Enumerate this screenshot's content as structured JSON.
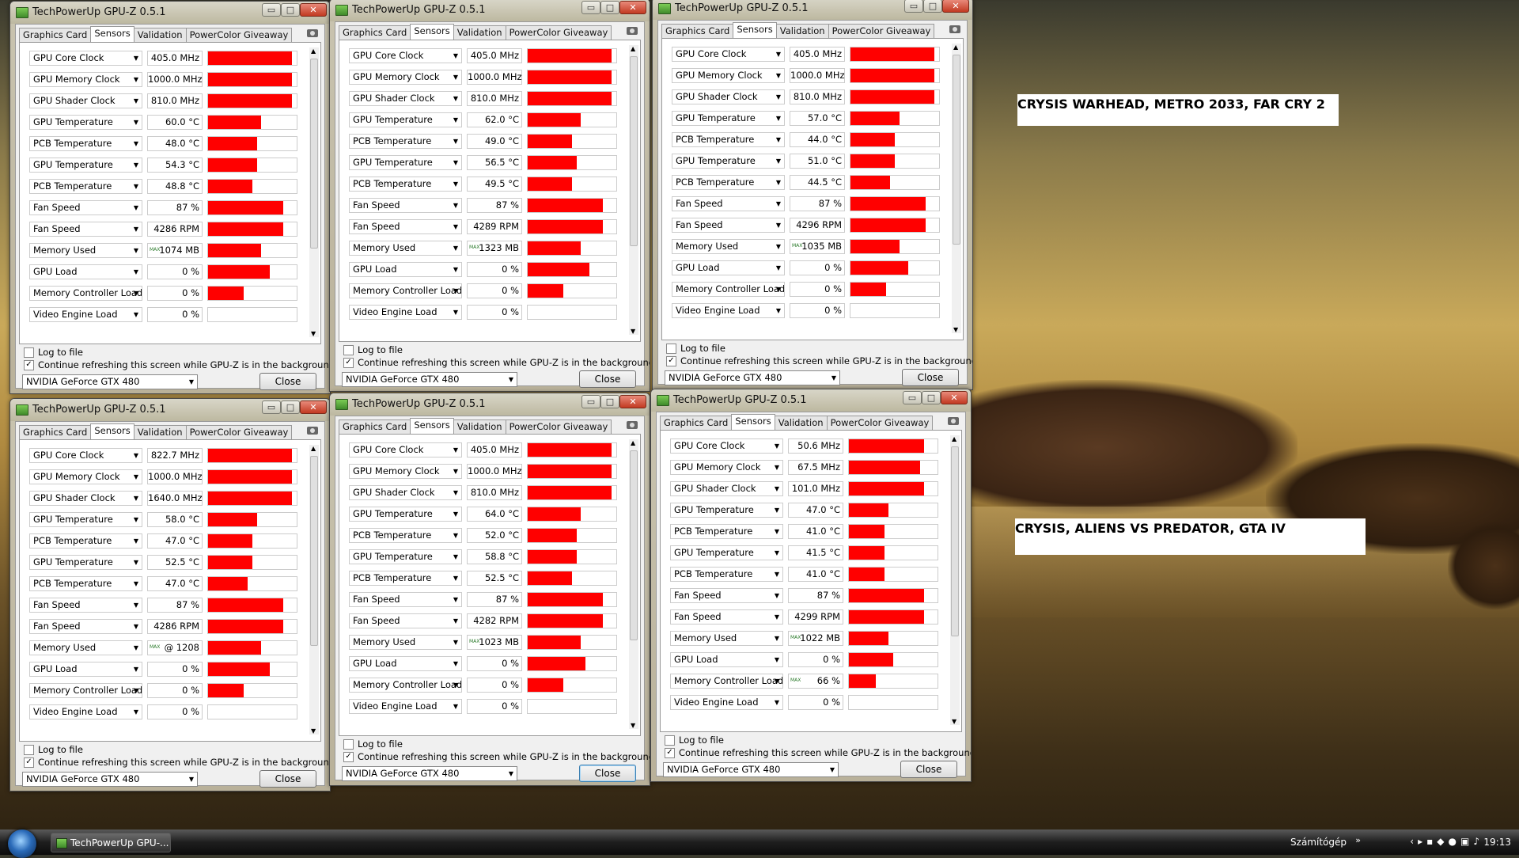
{
  "desktop": {
    "captions": [
      "CRYSIS WARHEAD, METRO 2033, FAR CRY 2",
      "CRYSIS, ALIENS VS PREDATOR, GTA IV"
    ]
  },
  "common": {
    "title": "TechPowerUp GPU-Z 0.5.1",
    "tabs": [
      "Graphics Card",
      "Sensors",
      "Validation",
      "PowerColor Giveaway"
    ],
    "log_label": "Log to file",
    "continue_label": "Continue refreshing this screen while GPU-Z is in the background",
    "gpu_select": "NVIDIA GeForce GTX 480",
    "close_label": "Close",
    "min_glyph": "▭",
    "max_glyph": "□",
    "close_glyph": "✕",
    "arrow": "▼",
    "max_tag": "MAX",
    "check_glyph": "✓"
  },
  "windows": [
    {
      "sensors": [
        {
          "name": "GPU Core Clock",
          "value": "405.0 MHz",
          "level": 0.95
        },
        {
          "name": "GPU Memory Clock",
          "value": "1000.0 MHz",
          "level": 0.95
        },
        {
          "name": "GPU Shader Clock",
          "value": "810.0 MHz",
          "level": 0.95
        },
        {
          "name": "GPU Temperature",
          "value": "60.0 °C",
          "level": 0.6
        },
        {
          "name": "PCB Temperature",
          "value": "48.0 °C",
          "level": 0.55
        },
        {
          "name": "GPU Temperature",
          "value": "54.3 °C",
          "level": 0.55
        },
        {
          "name": "PCB Temperature",
          "value": "48.8 °C",
          "level": 0.5
        },
        {
          "name": "Fan Speed",
          "value": "87 %",
          "level": 0.85
        },
        {
          "name": "Fan Speed",
          "value": "4286 RPM",
          "level": 0.85
        },
        {
          "name": "Memory Used",
          "value": "1074 MB",
          "level": 0.6,
          "max": true
        },
        {
          "name": "GPU Load",
          "value": "0 %",
          "level": 0.7
        },
        {
          "name": "Memory Controller Load",
          "value": "0 %",
          "level": 0.4
        },
        {
          "name": "Video Engine Load",
          "value": "0 %",
          "level": 0.0
        }
      ]
    },
    {
      "sensors": [
        {
          "name": "GPU Core Clock",
          "value": "405.0 MHz",
          "level": 0.95
        },
        {
          "name": "GPU Memory Clock",
          "value": "1000.0 MHz",
          "level": 0.95
        },
        {
          "name": "GPU Shader Clock",
          "value": "810.0 MHz",
          "level": 0.95
        },
        {
          "name": "GPU Temperature",
          "value": "62.0 °C",
          "level": 0.6
        },
        {
          "name": "PCB Temperature",
          "value": "49.0 °C",
          "level": 0.5
        },
        {
          "name": "GPU Temperature",
          "value": "56.5 °C",
          "level": 0.55
        },
        {
          "name": "PCB Temperature",
          "value": "49.5 °C",
          "level": 0.5
        },
        {
          "name": "Fan Speed",
          "value": "87 %",
          "level": 0.85
        },
        {
          "name": "Fan Speed",
          "value": "4289 RPM",
          "level": 0.85
        },
        {
          "name": "Memory Used",
          "value": "1323 MB",
          "level": 0.6,
          "max": true
        },
        {
          "name": "GPU Load",
          "value": "0 %",
          "level": 0.7
        },
        {
          "name": "Memory Controller Load",
          "value": "0 %",
          "level": 0.4
        },
        {
          "name": "Video Engine Load",
          "value": "0 %",
          "level": 0.0
        }
      ]
    },
    {
      "sensors": [
        {
          "name": "GPU Core Clock",
          "value": "405.0 MHz",
          "level": 0.95
        },
        {
          "name": "GPU Memory Clock",
          "value": "1000.0 MHz",
          "level": 0.95
        },
        {
          "name": "GPU Shader Clock",
          "value": "810.0 MHz",
          "level": 0.95
        },
        {
          "name": "GPU Temperature",
          "value": "57.0 °C",
          "level": 0.55
        },
        {
          "name": "PCB Temperature",
          "value": "44.0 °C",
          "level": 0.5
        },
        {
          "name": "GPU Temperature",
          "value": "51.0 °C",
          "level": 0.5
        },
        {
          "name": "PCB Temperature",
          "value": "44.5 °C",
          "level": 0.45
        },
        {
          "name": "Fan Speed",
          "value": "87 %",
          "level": 0.85
        },
        {
          "name": "Fan Speed",
          "value": "4296 RPM",
          "level": 0.85
        },
        {
          "name": "Memory Used",
          "value": "1035 MB",
          "level": 0.55,
          "max": true
        },
        {
          "name": "GPU Load",
          "value": "0 %",
          "level": 0.65
        },
        {
          "name": "Memory Controller Load",
          "value": "0 %",
          "level": 0.4
        },
        {
          "name": "Video Engine Load",
          "value": "0 %",
          "level": 0.0
        }
      ]
    },
    {
      "sensors": [
        {
          "name": "GPU Core Clock",
          "value": "822.7 MHz",
          "level": 0.95
        },
        {
          "name": "GPU Memory Clock",
          "value": "1000.0 MHz",
          "level": 0.95
        },
        {
          "name": "GPU Shader Clock",
          "value": "1640.0 MHz",
          "level": 0.95
        },
        {
          "name": "GPU Temperature",
          "value": "58.0 °C",
          "level": 0.55
        },
        {
          "name": "PCB Temperature",
          "value": "47.0 °C",
          "level": 0.5
        },
        {
          "name": "GPU Temperature",
          "value": "52.5 °C",
          "level": 0.5
        },
        {
          "name": "PCB Temperature",
          "value": "47.0 °C",
          "level": 0.45
        },
        {
          "name": "Fan Speed",
          "value": "87 %",
          "level": 0.85
        },
        {
          "name": "Fan Speed",
          "value": "4286 RPM",
          "level": 0.85
        },
        {
          "name": "Memory Used",
          "value": "@ 1208",
          "level": 0.6,
          "max": true
        },
        {
          "name": "GPU Load",
          "value": "0 %",
          "level": 0.7
        },
        {
          "name": "Memory Controller Load",
          "value": "0 %",
          "level": 0.4
        },
        {
          "name": "Video Engine Load",
          "value": "0 %",
          "level": 0.0
        }
      ]
    },
    {
      "sensors": [
        {
          "name": "GPU Core Clock",
          "value": "405.0 MHz",
          "level": 0.95
        },
        {
          "name": "GPU Memory Clock",
          "value": "1000.0 MHz",
          "level": 0.95
        },
        {
          "name": "GPU Shader Clock",
          "value": "810.0 MHz",
          "level": 0.95
        },
        {
          "name": "GPU Temperature",
          "value": "64.0 °C",
          "level": 0.6
        },
        {
          "name": "PCB Temperature",
          "value": "52.0 °C",
          "level": 0.55
        },
        {
          "name": "GPU Temperature",
          "value": "58.8 °C",
          "level": 0.55
        },
        {
          "name": "PCB Temperature",
          "value": "52.5 °C",
          "level": 0.5
        },
        {
          "name": "Fan Speed",
          "value": "87 %",
          "level": 0.85
        },
        {
          "name": "Fan Speed",
          "value": "4282 RPM",
          "level": 0.85
        },
        {
          "name": "Memory Used",
          "value": "1023 MB",
          "level": 0.6,
          "max": true
        },
        {
          "name": "GPU Load",
          "value": "0 %",
          "level": 0.65
        },
        {
          "name": "Memory Controller Load",
          "value": "0 %",
          "level": 0.4
        },
        {
          "name": "Video Engine Load",
          "value": "0 %",
          "level": 0.0
        }
      ]
    },
    {
      "sensors": [
        {
          "name": "GPU Core Clock",
          "value": "50.6 MHz",
          "level": 0.85
        },
        {
          "name": "GPU Memory Clock",
          "value": "67.5 MHz",
          "level": 0.8
        },
        {
          "name": "GPU Shader Clock",
          "value": "101.0 MHz",
          "level": 0.85
        },
        {
          "name": "GPU Temperature",
          "value": "47.0 °C",
          "level": 0.45
        },
        {
          "name": "PCB Temperature",
          "value": "41.0 °C",
          "level": 0.4
        },
        {
          "name": "GPU Temperature",
          "value": "41.5 °C",
          "level": 0.4
        },
        {
          "name": "PCB Temperature",
          "value": "41.0 °C",
          "level": 0.4
        },
        {
          "name": "Fan Speed",
          "value": "87 %",
          "level": 0.85
        },
        {
          "name": "Fan Speed",
          "value": "4299 RPM",
          "level": 0.85
        },
        {
          "name": "Memory Used",
          "value": "1022 MB",
          "level": 0.45,
          "max": true
        },
        {
          "name": "GPU Load",
          "value": "0 %",
          "level": 0.5
        },
        {
          "name": "Memory Controller Load",
          "value": "66 %",
          "level": 0.3,
          "max": true
        },
        {
          "name": "Video Engine Load",
          "value": "0 %",
          "level": 0.0
        }
      ]
    }
  ],
  "taskbar": {
    "task_label": "TechPowerUp GPU-...",
    "tray_label": "Számítógép",
    "tray_chevron": "»",
    "tray_icons": [
      "‹",
      "▸",
      "▪",
      "◆",
      "●",
      "▣",
      "♪"
    ],
    "clock": "19:13"
  }
}
